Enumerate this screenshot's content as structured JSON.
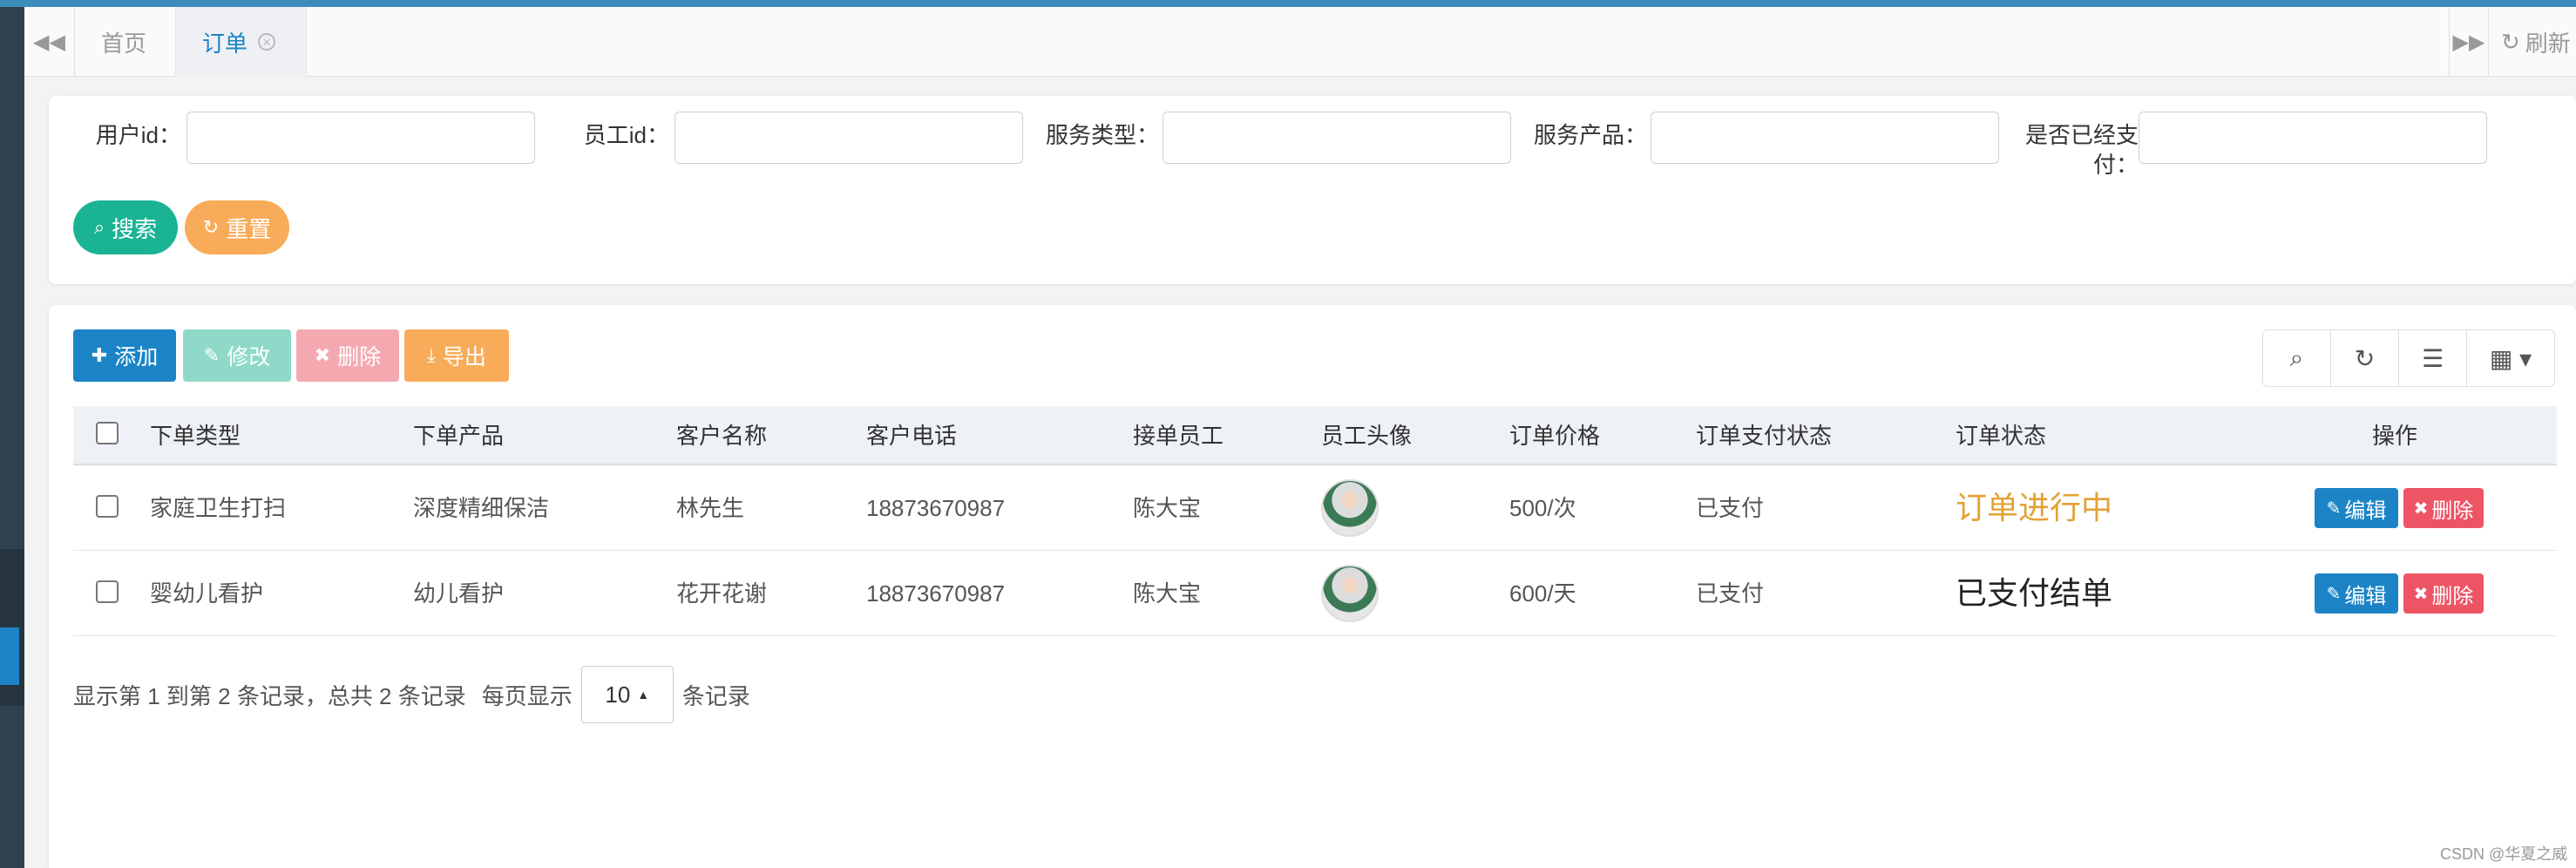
{
  "tabs": {
    "items": [
      {
        "label": "首页"
      },
      {
        "label": "订单"
      }
    ],
    "refresh_label": "刷新"
  },
  "search": {
    "fields": [
      {
        "label": "用户id：",
        "value": ""
      },
      {
        "label": "员工id：",
        "value": ""
      },
      {
        "label": "服务类型：",
        "value": ""
      },
      {
        "label": "服务产品：",
        "value": ""
      },
      {
        "label": "是否已经支付：",
        "value": ""
      }
    ],
    "search_label": "搜索",
    "reset_label": "重置"
  },
  "toolbar": {
    "add_label": "添加",
    "edit_label": "修改",
    "delete_label": "删除",
    "export_label": "导出"
  },
  "table": {
    "columns": [
      "下单类型",
      "下单产品",
      "客户名称",
      "客户电话",
      "接单员工",
      "员工头像",
      "订单价格",
      "订单支付状态",
      "订单状态",
      "操作"
    ],
    "rows": [
      {
        "type": "家庭卫生打扫",
        "product": "深度精细保洁",
        "customer": "林先生",
        "phone": "18873670987",
        "staff": "陈大宝",
        "price": "500/次",
        "pay_status": "已支付",
        "order_status": "订单进行中",
        "edit": "编辑",
        "delete": "删除"
      },
      {
        "type": "婴幼儿看护",
        "product": "幼儿看护",
        "customer": "花开花谢",
        "phone": "18873670987",
        "staff": "陈大宝",
        "price": "600/天",
        "pay_status": "已支付",
        "order_status": "已支付结单",
        "edit": "编辑",
        "delete": "删除"
      }
    ]
  },
  "pager": {
    "summary": "显示第 1 到第 2 条记录，总共 2 条记录",
    "per_page_prefix": "每页显示",
    "page_size": "10",
    "per_page_suffix": "条记录"
  },
  "watermark": "CSDN @华夏之威",
  "colors": {
    "primary": "#1c84c6",
    "success": "#1ab394",
    "warning": "#f8ac59",
    "danger": "#ed5565",
    "status_ongoing": "#e2a233"
  }
}
